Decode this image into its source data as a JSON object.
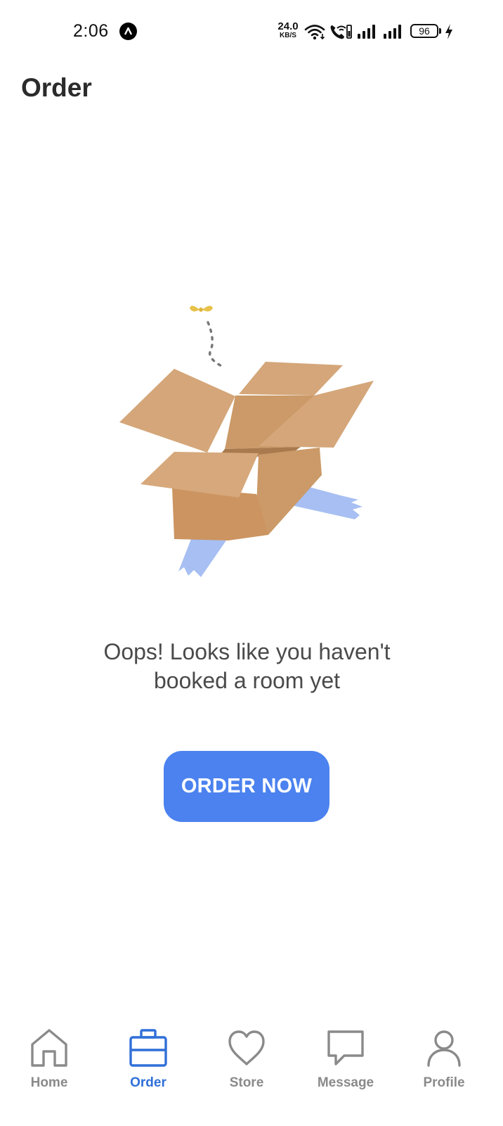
{
  "status_bar": {
    "time": "2:06",
    "net_speed_value": "24.0",
    "net_speed_unit": "KB/S",
    "battery_level": "96",
    "icons": [
      "app-notification-icon",
      "wifi-icon",
      "wifi-calling-icon",
      "signal-icon",
      "signal-icon",
      "battery-icon",
      "charging-icon"
    ]
  },
  "header": {
    "title": "Order"
  },
  "empty_state": {
    "illustration": "open-box-illustration",
    "message_line1": "Oops! Looks like you haven't",
    "message_line2": "booked a room yet",
    "button_label": "ORDER NOW"
  },
  "bottom_nav": {
    "items": [
      {
        "label": "Home",
        "icon": "home-icon",
        "active": false
      },
      {
        "label": "Order",
        "icon": "briefcase-icon",
        "active": true
      },
      {
        "label": "Store",
        "icon": "heart-icon",
        "active": false
      },
      {
        "label": "Message",
        "icon": "chat-icon",
        "active": false
      },
      {
        "label": "Profile",
        "icon": "user-icon",
        "active": false
      }
    ]
  },
  "colors": {
    "accent": "#4b82ef",
    "active_nav": "#2f6fd8",
    "inactive_nav": "#8a8a8a",
    "title_text": "#2b2b2b",
    "message_text": "#4a4a4a",
    "background": "#ffffff"
  }
}
